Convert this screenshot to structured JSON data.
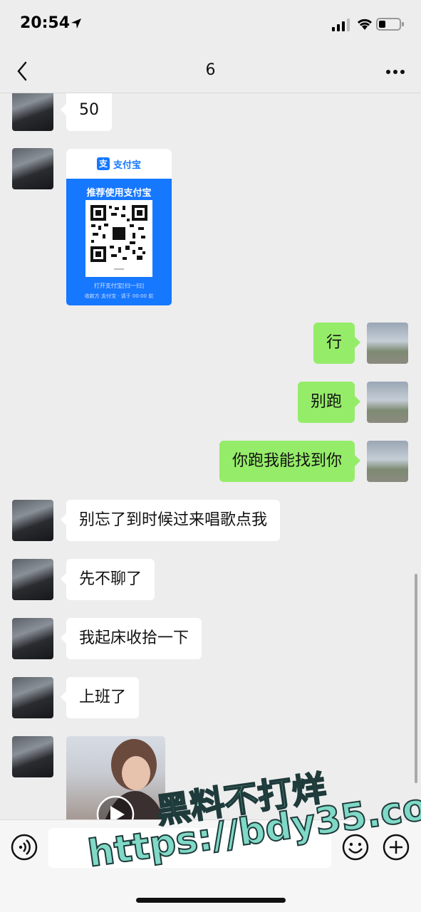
{
  "status": {
    "time": "20:54"
  },
  "header": {
    "title": "6"
  },
  "messages": {
    "m1": "50",
    "m3": "行",
    "m4": "别跑",
    "m5": "你跑我能找到你",
    "m6": "别忘了到时候过来唱歌点我",
    "m7": "先不聊了",
    "m8": "我起床收拾一下",
    "m9": "上班了"
  },
  "alipay_card": {
    "logo_char": "支",
    "brand": "支付宝",
    "headline": "推荐使用支付宝",
    "footer1": "打开支付宝[扫一扫]",
    "footer2": "收款方 支付宝 · 请于 00:00 前"
  },
  "watermark": {
    "line1": "黑料不打烊",
    "line2": "https://bdy35.co"
  },
  "colors": {
    "background": "#ededed",
    "sent_bubble": "#95ec69",
    "received_bubble": "#ffffff",
    "alipay_blue": "#1677ff"
  }
}
